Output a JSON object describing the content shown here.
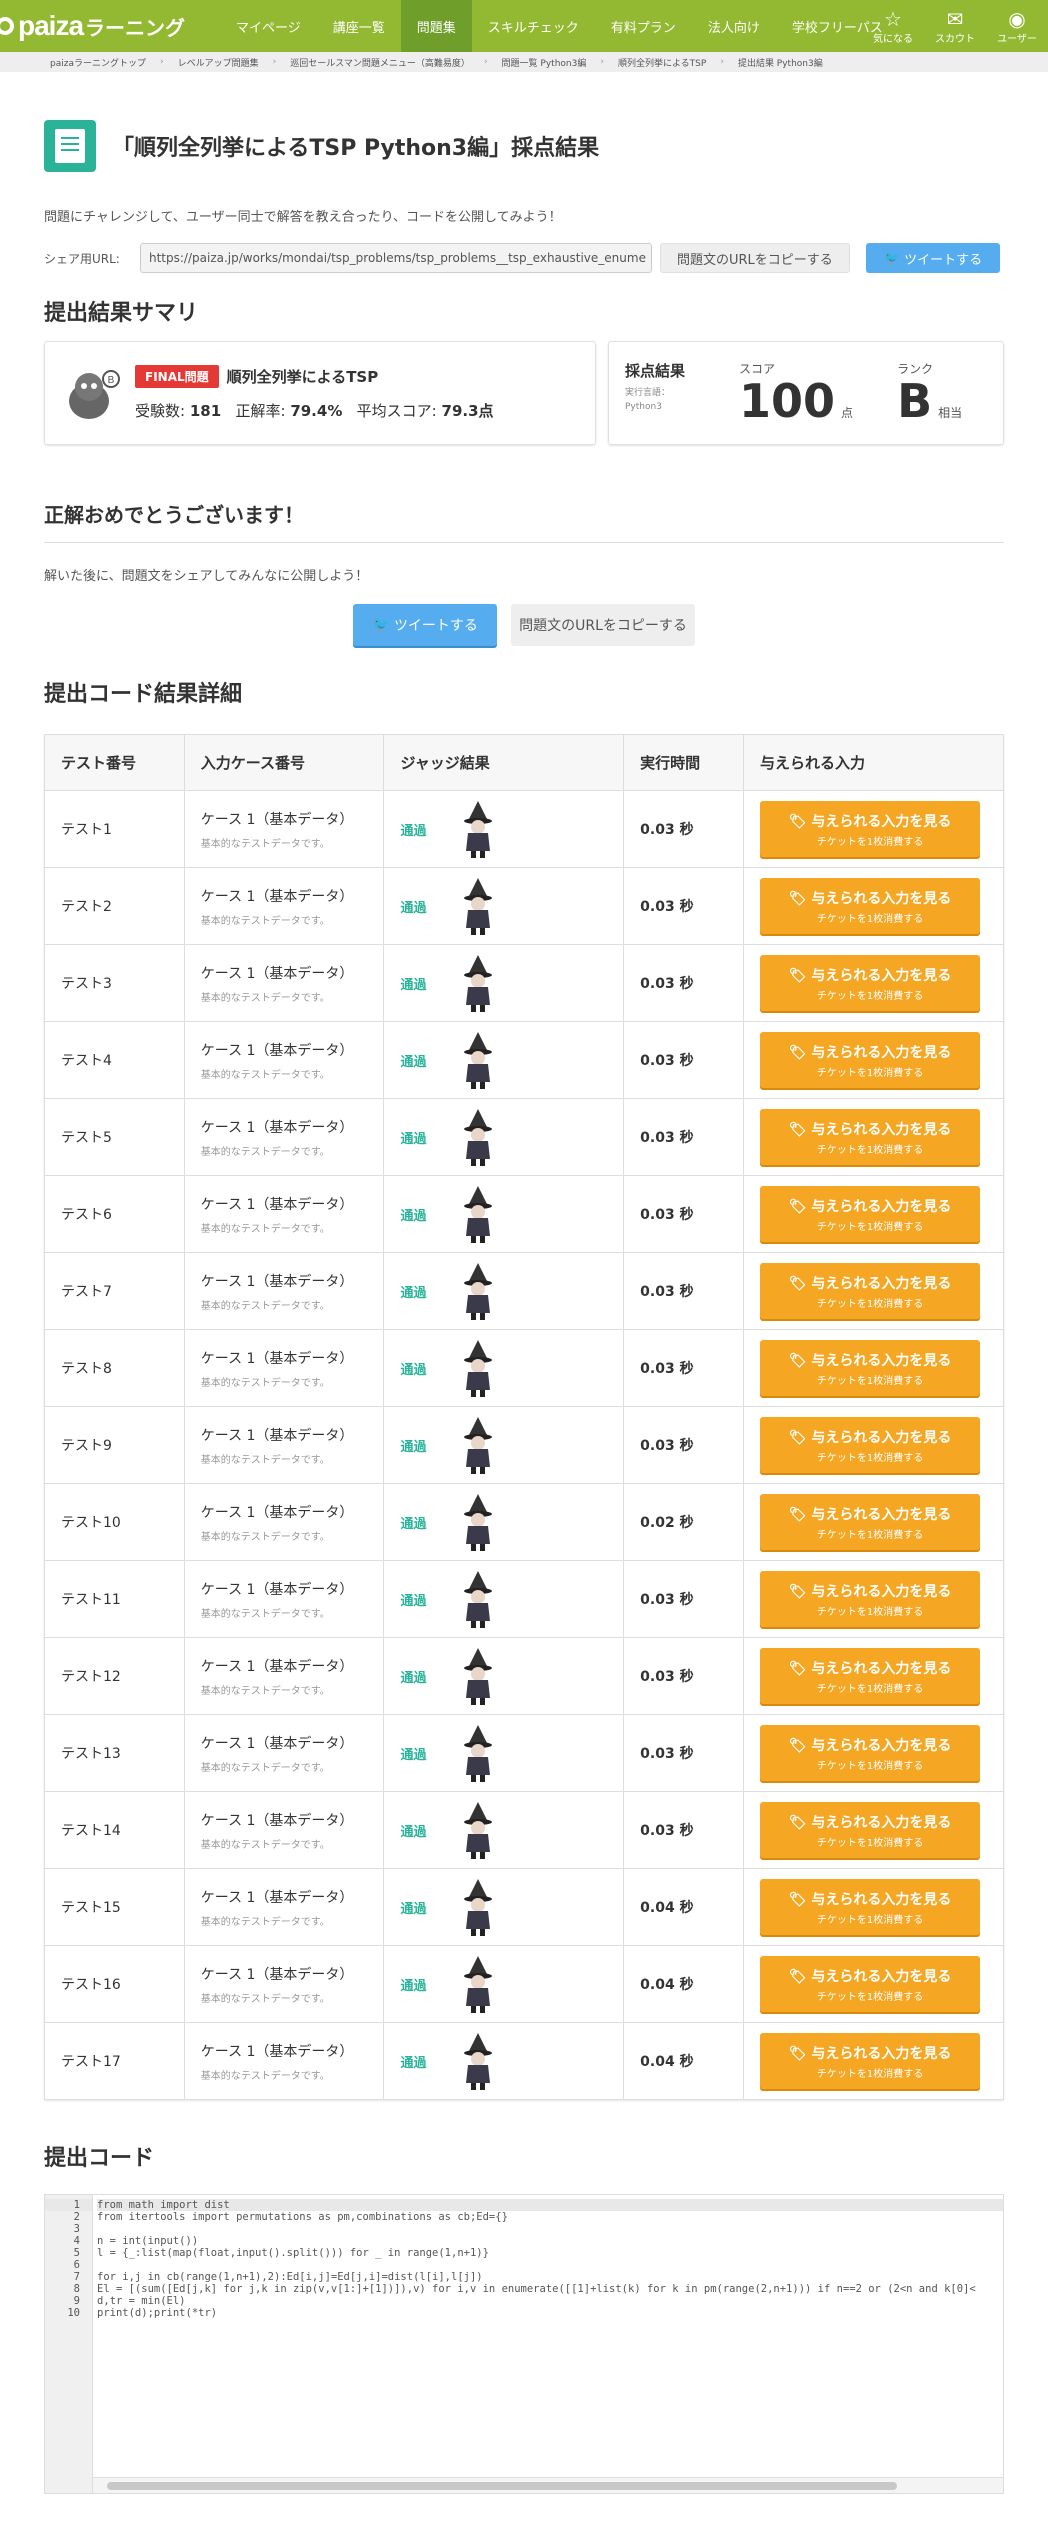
{
  "nav": {
    "logo_text": "paiza",
    "logo_sub": "ラーニング",
    "links": [
      "マイページ",
      "講座一覧",
      "問題集",
      "スキルチェック",
      "有料プラン",
      "法人向け",
      "学校フリーパス"
    ],
    "icons": [
      {
        "label": "気になる",
        "icon": "star-icon"
      },
      {
        "label": "スカウト",
        "icon": "mail-icon"
      },
      {
        "label": "ユーザー",
        "icon": "user-icon"
      }
    ]
  },
  "breadcrumb": [
    "paizaラーニングトップ",
    "レベルアップ問題集",
    "巡回セールスマン問題メニュー（高難易度）",
    "問題一覧 Python3編",
    "順列全列挙によるTSP",
    "提出結果 Python3編"
  ],
  "page": {
    "title": "「順列全列挙によるTSP Python3編」採点結果",
    "intro": "問題にチャレンジして、ユーザー同士で解答を教え合ったり、コードを公開してみよう！",
    "share_label": "シェア用URL:",
    "share_url": "https://paiza.jp/works/mondai/tsp_problems/tsp_problems__tsp_exhaustive_enume",
    "copy_url": "問題文のURLをコピーする",
    "tweet": "ツイートする"
  },
  "summary": {
    "heading": "提出結果サマリ",
    "badge": "FINAL問題",
    "problem": "順列全列挙によるTSP",
    "stat_examinees_label": "受験数:",
    "stat_examinees": "181",
    "stat_rate_label": "正解率:",
    "stat_rate": "79.4%",
    "stat_avg_label": "平均スコア:",
    "stat_avg": "79.3点",
    "result_title": "採点結果",
    "lang_label": "実行言語：",
    "lang": "Python3",
    "score_label": "スコア",
    "score": "100",
    "score_unit": "点",
    "rank_label": "ランク",
    "rank": "B",
    "rank_unit": "相当"
  },
  "congrats": {
    "heading": "正解おめでとうございます！",
    "sub": "解いた後に、問題文をシェアしてみんなに公開しよう！",
    "tweet": "ツイートする",
    "copy": "問題文のURLをコピーする"
  },
  "detail": {
    "heading": "提出コード結果詳細",
    "columns": [
      "テスト番号",
      "入力ケース番号",
      "ジャッジ結果",
      "実行時間",
      "与えられる入力"
    ],
    "case_main": "ケース 1（基本データ）",
    "case_sub": "基本的なテストデータです。",
    "pass": "通過",
    "btn_main": "与えられる入力を見る",
    "btn_sub": "チケットを1枚消費する",
    "rows": [
      {
        "test": "テスト1",
        "time": "0.03 秒"
      },
      {
        "test": "テスト2",
        "time": "0.03 秒"
      },
      {
        "test": "テスト3",
        "time": "0.03 秒"
      },
      {
        "test": "テスト4",
        "time": "0.03 秒"
      },
      {
        "test": "テスト5",
        "time": "0.03 秒"
      },
      {
        "test": "テスト6",
        "time": "0.03 秒"
      },
      {
        "test": "テスト7",
        "time": "0.03 秒"
      },
      {
        "test": "テスト8",
        "time": "0.03 秒"
      },
      {
        "test": "テスト9",
        "time": "0.03 秒"
      },
      {
        "test": "テスト10",
        "time": "0.02 秒"
      },
      {
        "test": "テスト11",
        "time": "0.03 秒"
      },
      {
        "test": "テスト12",
        "time": "0.03 秒"
      },
      {
        "test": "テスト13",
        "time": "0.03 秒"
      },
      {
        "test": "テスト14",
        "time": "0.03 秒"
      },
      {
        "test": "テスト15",
        "time": "0.04 秒"
      },
      {
        "test": "テスト16",
        "time": "0.04 秒"
      },
      {
        "test": "テスト17",
        "time": "0.04 秒"
      }
    ]
  },
  "code": {
    "heading": "提出コード",
    "lines": [
      "from math import dist",
      "from itertools import permutations as pm,combinations as cb;Ed={}",
      "",
      "n = int(input())",
      "l = {_:list(map(float,input().split())) for _ in range(1,n+1)}",
      "",
      "for i,j in cb(range(1,n+1),2):Ed[i,j]=Ed[j,i]=dist(l[i],l[j])",
      "El = [(sum([Ed[j,k] for j,k in zip(v,v[1:]+[1])]),v) for i,v in enumerate([[1]+list(k) for k in pm(range(2,n+1))) if n==2 or (2<n and k[0]<",
      "d,tr = min(El)",
      "print(d);print(*tr)"
    ]
  },
  "colors": {
    "nav": "#93b831",
    "accent": "#2bb39a",
    "tweet": "#55acee",
    "orange": "#f5a623",
    "final": "#e53935"
  }
}
